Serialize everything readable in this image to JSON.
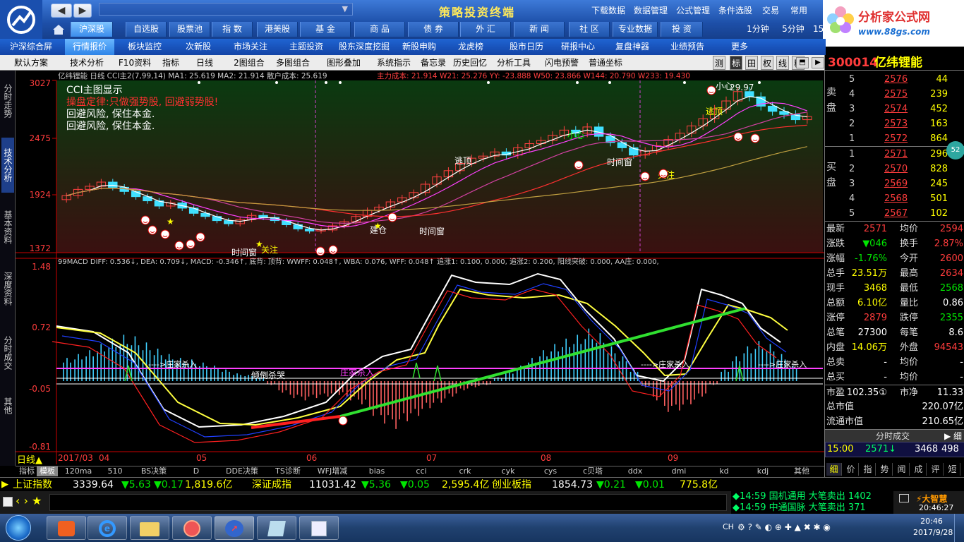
{
  "app": {
    "title": "策略投资终端",
    "address_arrow": "▼"
  },
  "top_menu": [
    "下载数据",
    "数据管理",
    "公式管理",
    "条件选股",
    "交易",
    "常用"
  ],
  "brand": {
    "name": "分析家公式网",
    "url": "www.88gs.com"
  },
  "row2_tabs": [
    "沪深股",
    "自选股",
    "股票池",
    "指 数",
    "港美股",
    "基 金",
    "商 品",
    "债 券",
    "外 汇",
    "新 闻",
    "社 区",
    "专业数据",
    "投 资",
    "1分钟",
    "5分钟",
    "15"
  ],
  "row3_tabs": [
    "沪深综合屏",
    "行情报价",
    "板块监控",
    "次新股",
    "市场关注",
    "主题投资",
    "股东深度挖掘",
    "新股申购",
    "龙虎榜",
    "股市日历",
    "研报中心",
    "复盘神器",
    "业绩预告",
    "更多"
  ],
  "row4_tools": [
    "默认方案",
    "技术分析",
    "F10资料",
    "指标",
    "日线",
    "2图组合",
    "多图组合",
    "图形叠加",
    "系统指示",
    "备忘录",
    "历史回忆",
    "分析工具",
    "闪电预警",
    "普通坐标"
  ],
  "row4_sq": [
    "测",
    "标",
    "田",
    "权",
    "线",
    "移"
  ],
  "left_tabs": [
    "分时走势",
    "技术分析",
    "基本资料",
    "深度资料",
    "分时成交",
    "其他"
  ],
  "chart": {
    "main_header": "亿纬锂能 日线 CCI主2(7,99,14) MA1: 25.619 MA2: 21.914 散户成本: 25.619",
    "main_header2": "主力成本: 21.914 W21: 25.276 YY: -23.888 W50: 23.866 W144: 20.790 W233: 19.430",
    "notes": [
      "CCI主图显示",
      "操盘定律:只做强势股, 回避弱势股!",
      "回避风险, 保住本金.",
      "回避风险, 保住本金."
    ],
    "price_axis": [
      "3027",
      "2475",
      "1924",
      "1372"
    ],
    "macd_header": "99MACD DIFF: 0.536↓, DEA: 0.709↓, MACD: -0.346↑, 底背: 顶背: WWFF: 0.048↑, WBA: 0.076, WFF: 0.048↑ 追涨1: 0.100, 0.000, 追涨2: 0.200, 阳线突破: 0.000, AA庄: 0.000,",
    "macd_axis": [
      "1.48",
      "0.72",
      "-0.05",
      "-0.81"
    ],
    "months": [
      "2017/03",
      "04",
      "05",
      "06",
      "07",
      "08",
      "09"
    ],
    "labels": [
      "时间窗",
      "关注",
      "建仓",
      "时间窗",
      "小心",
      "时间窗",
      "关注",
      "逃顶",
      "逃顶",
      "小心",
      "29.97",
      "庄家杀入",
      "庄家杀入",
      "庄家杀入",
      "倾倒杀哭",
      "庄家杀入",
      "日线"
    ],
    "main_closes": [
      19.2,
      19.8,
      20.1,
      20.5,
      20.0,
      19.6,
      19.1,
      18.7,
      18.2,
      18.5,
      18.0,
      17.5,
      17.2,
      16.8,
      16.5,
      16.9,
      17.3,
      17.1,
      16.8,
      16.4,
      16.0,
      15.8,
      15.9,
      16.3,
      16.7,
      17.2,
      17.8,
      18.1,
      18.6,
      19.0,
      19.5,
      20.3,
      21.0,
      21.6,
      22.3,
      22.8,
      23.0,
      23.4,
      23.1,
      23.8,
      24.2,
      24.5,
      25.0,
      25.5,
      25.2,
      25.8,
      24.9,
      24.3,
      23.8,
      23.1,
      23.5,
      24.0,
      24.6,
      25.2,
      25.9,
      26.6,
      27.5,
      28.3,
      29.2,
      28.7,
      27.8,
      27.3,
      27.0,
      26.5,
      26.8
    ],
    "macd_bars": [
      -0.3,
      -0.35,
      -0.4,
      -0.48,
      -0.55,
      -0.6,
      -0.58,
      -0.5,
      -0.42,
      -0.35,
      -0.3,
      -0.28,
      -0.24,
      -0.2,
      -0.15,
      -0.1,
      -0.08,
      -0.05,
      0.05,
      0.15,
      0.22,
      0.25,
      0.22,
      0.2,
      0.18,
      0.25,
      0.3,
      0.45,
      0.55,
      0.62,
      0.52,
      0.45,
      0.35,
      0.28,
      0.2,
      0.12,
      0.08,
      0.05,
      -0.05,
      -0.12,
      -0.2,
      -0.3,
      -0.4,
      -0.48,
      -0.55,
      -0.6,
      -0.68,
      -0.62,
      -0.45,
      -0.32,
      -0.15,
      0.08,
      0.25,
      0.4,
      0.38,
      0.3,
      0.2,
      0.05,
      -0.15,
      -0.32,
      -0.45,
      -0.52,
      -0.48,
      -0.35,
      -0.2
    ]
  },
  "bottom_tabs": [
    "指标",
    "模板",
    "120ma",
    "510",
    "BS决策",
    "D",
    "DDE决策",
    "TS诊断",
    "WFJ增减",
    "bias",
    "cci",
    "crk",
    "cyk",
    "cys",
    "c贝塔",
    "ddx",
    "dmi",
    "kd",
    "kdj",
    "其他"
  ],
  "stock": {
    "code": "300014",
    "name": "亿纬锂能"
  },
  "asks": [
    [
      "5",
      "2576",
      "44"
    ],
    [
      "4",
      "2575",
      "239"
    ],
    [
      "3",
      "2574",
      "452"
    ],
    [
      "2",
      "2573",
      "163"
    ],
    [
      "1",
      "2572",
      "864"
    ]
  ],
  "bids": [
    [
      "1",
      "2571",
      "296"
    ],
    [
      "2",
      "2570",
      "828"
    ],
    [
      "3",
      "2569",
      "245"
    ],
    [
      "4",
      "2568",
      "501"
    ],
    [
      "5",
      "2567",
      "102"
    ]
  ],
  "quote": [
    [
      "最新",
      "2571",
      "均价",
      "2594"
    ],
    [
      "涨跌",
      "▼046",
      "换手",
      "2.87%"
    ],
    [
      "涨幅",
      "-1.76%",
      "今开",
      "2600"
    ],
    [
      "总手",
      "23.51万",
      "最高",
      "2634"
    ],
    [
      "现手",
      "3468",
      "最低",
      "2568"
    ],
    [
      "总额",
      "6.10亿",
      "量比",
      "0.86"
    ],
    [
      "涨停",
      "2879",
      "跌停",
      "2355"
    ],
    [
      "总笔",
      "27300",
      "每笔",
      "8.6"
    ],
    [
      "内盘",
      "14.06万",
      "外盘",
      "94543"
    ],
    [
      "总卖",
      "-",
      "均价",
      "-"
    ],
    [
      "总买",
      "-",
      "均价",
      "-"
    ],
    [
      "市盈",
      "102.35①",
      "市净",
      "11.33"
    ],
    [
      "总市值",
      "",
      "",
      "220.07亿"
    ],
    [
      "流通市值",
      "",
      "",
      "210.65亿"
    ]
  ],
  "fenshi": {
    "label": "分时成交",
    "btn": "▶ 细",
    "time": "15:00",
    "price": "2571↓",
    "vol": "3468",
    "vol2": "498"
  },
  "rp_tabs": [
    "细",
    "价",
    "指",
    "势",
    "闻",
    "成",
    "评",
    "短"
  ],
  "ticker": {
    "sh_name": "上证指数",
    "sh_val": "3339.64",
    "sh_chg": "▼5.63",
    "sh_pct": "▼0.17",
    "sh_amt": "1,819.6亿",
    "sz_name": "深证成指",
    "sz_val": "11031.42",
    "sz_chg": "▼5.36",
    "sz_pct": "▼0.05",
    "sz_amt": "2,595.4亿",
    "cy_name": "创业板指",
    "cy_val": "1854.73",
    "cy_chg": "▼0.21",
    "cy_pct": "▼0.01",
    "cy_amt": "775.8亿"
  },
  "alerts": [
    "◆14:59 国机通用 大笔卖出 1402",
    "◆14:59 中通国脉 大笔卖出 371"
  ],
  "status_time": "20:46:27",
  "clock": {
    "time": "20:46",
    "date": "2017/9/28"
  },
  "tray": "CH",
  "badge": "52"
}
